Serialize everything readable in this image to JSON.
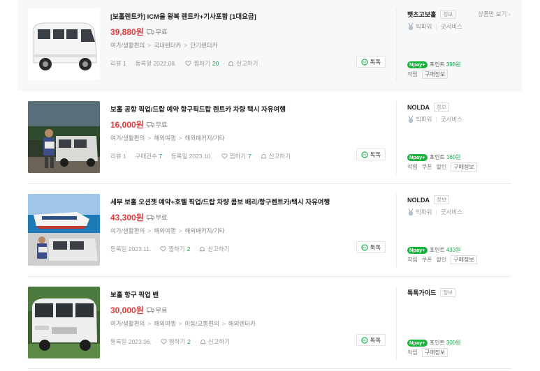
{
  "items": [
    {
      "title": "[보홀렌트카] ICM을 왕복 렌트카+기사포함 [1대요금]",
      "price": "39,880원",
      "shipping": "무료",
      "category": [
        "여가/생활편의",
        "국내렌터카",
        "단기렌터카"
      ],
      "review_label": "리뷰",
      "review_count": "1",
      "purchase_label": "",
      "purchase_count": "",
      "reg_label": "등록일",
      "reg_date": "2022.08.",
      "wish_label": "찜하기",
      "wish_count": "20",
      "report_label": "신고하기",
      "talk_label": "톡톡",
      "seller": "햇츠고보홀",
      "info_label": "정보",
      "grade": "빅파워",
      "service": "굿서비스",
      "npay_label": "포인트",
      "points": "398원",
      "tags": [
        "적립"
      ],
      "tag_box": "구매정보",
      "more_link": "상품만 보기"
    },
    {
      "title": "보홀 공항 픽업/드랍 예약 항구픽드랍 렌트카 차량 택시 자유여행",
      "price": "16,000원",
      "shipping": "무료",
      "category": [
        "여가/생활편의",
        "해외여행",
        "해외패키지/기타"
      ],
      "review_label": "리뷰",
      "review_count": "1",
      "purchase_label": "구매건수",
      "purchase_count": "7",
      "reg_label": "등록일",
      "reg_date": "2023.10.",
      "wish_label": "찜하기",
      "wish_count": "7",
      "report_label": "신고하기",
      "talk_label": "톡톡",
      "seller": "NOLDA",
      "info_label": "정보",
      "grade": "빅파워",
      "service": "굿서비스",
      "npay_label": "포인트",
      "points": "160원",
      "tags": [
        "적립",
        "쿠폰",
        "할인"
      ],
      "tag_box": "구매정보"
    },
    {
      "title": "세부 보홀 오션젯 예약+호텔 픽업/드랍 차량 콤보 배리/항구렌트카/택시 자유여행",
      "price": "43,300원",
      "shipping": "무료",
      "category": [
        "여가/생활편의",
        "해외여행",
        "해외패키지/기타"
      ],
      "reg_label": "등록일",
      "reg_date": "2023.11.",
      "wish_label": "찜하기",
      "wish_count": "2",
      "report_label": "신고하기",
      "talk_label": "톡톡",
      "seller": "NOLDA",
      "info_label": "정보",
      "grade": "빅파워",
      "service": "굿서비스",
      "npay_label": "포인트",
      "points": "433원",
      "tags": [
        "적립",
        "쿠폰",
        "할인"
      ],
      "tag_box": "구매정보"
    },
    {
      "title": "보홀 항구 픽업 밴",
      "price": "30,000원",
      "shipping": "무료",
      "category": [
        "여가/생활편의",
        "해외여행",
        "이동/교통편의",
        "해외렌터카"
      ],
      "reg_label": "등록일",
      "reg_date": "2023.06.",
      "wish_label": "찜하기",
      "wish_count": "2",
      "report_label": "신고하기",
      "talk_label": "톡톡",
      "seller": "톡톡가이드",
      "info_label": "정보",
      "npay_label": "포인트",
      "points": "300원",
      "tags": [
        "적립"
      ],
      "tag_box": "구매정보"
    }
  ],
  "colors": {
    "price": "#e23b3b",
    "npay": "#16b33b",
    "green_count": "#16a34a"
  }
}
